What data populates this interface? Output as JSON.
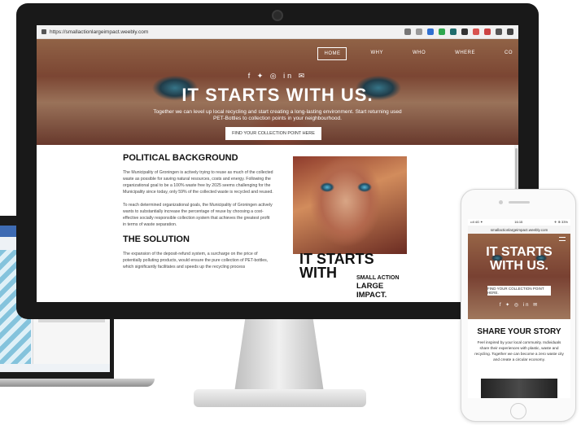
{
  "browser": {
    "url": "https://smallactionlargeimpact.weebly.com"
  },
  "nav": {
    "items": [
      {
        "label": "HOME"
      },
      {
        "label": "WHY"
      },
      {
        "label": "WHO"
      },
      {
        "label": "WHERE"
      },
      {
        "label": "CO"
      }
    ]
  },
  "hero": {
    "title": "IT STARTS WITH US.",
    "subtitle": "Together we can level up local recycling and start creating a long-lasting environment. Start returning used PET-Bottles to collection points in your neighbourhood.",
    "button_label": "FIND YOUR COLLECTION POINT HERE",
    "social_icons": "f ✦ ◎ in ✉"
  },
  "content": {
    "political_heading": "POLITICAL BACKGROUND",
    "political_p1": "The Municipality of Groningen is actively trying to reuse as much of the collected waste as possible for saving natural resources, costs and energy. Following the organizational goal to be a 100% waste free by 2025 seems challenging for the Municipality since today, only 59% of the collected waste is recycled and reused.",
    "political_p2": "To reach determined organizational goals, the Municipality of Groningen actively wants to substantially increase the percentage of reuse by choosing a cost-effective socially responsible collection system that achieves the greatest profit in terms of waste separation.",
    "solution_heading": "THE SOLUTION",
    "solution_p": "The expansion of the deposit-refund system, a surcharge on the price of potentially polluting products, would ensure the pure collection of PET-bottles, which significantly facilitates and speeds up the recycling process"
  },
  "poster": {
    "big_text": "IT STARTS WITH",
    "tag1": "SMALL ACTION",
    "tag2": "LARGE IMPACT."
  },
  "phone": {
    "status_left": "••ll 4G ✦",
    "status_time": "16:15",
    "status_right": "✈ ⊕ 33%",
    "url": "smallactionlargeimpact.weebly.com",
    "hero_title": "IT STARTS WITH US.",
    "button_label": "FIND YOUR COLLECTION POINT HERE.",
    "social_icons": "f ✦ ◎ in ✉",
    "section_heading": "SHARE YOUR STORY",
    "section_text": "Feel inspired by your local community. Individuals share their experiences with plastic, waste and recycling. Together we can become a zero waste city and create a circular economy."
  }
}
